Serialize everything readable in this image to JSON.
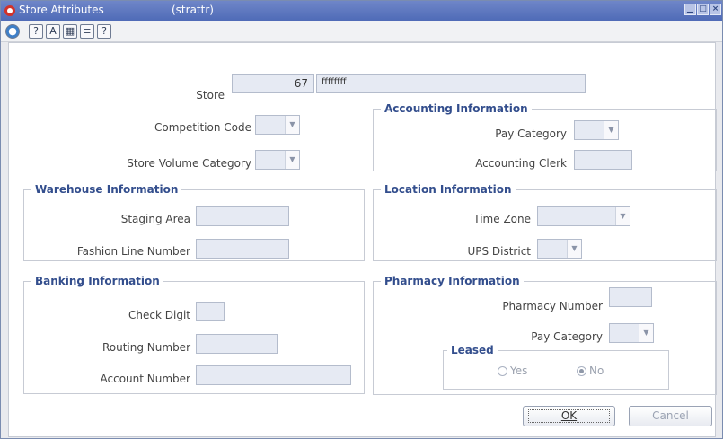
{
  "window": {
    "title": "Store Attributes",
    "code": "(strattr)"
  },
  "toolbar": {
    "icons": [
      "globe-icon",
      "help-icon",
      "text-icon",
      "table-icon",
      "document-icon",
      "question-icon"
    ]
  },
  "store": {
    "label": "Store",
    "number": "67",
    "name": "ffffffff"
  },
  "competition": {
    "label": "Competition Code",
    "value": ""
  },
  "volume": {
    "label": "Store Volume Category",
    "value": ""
  },
  "accounting": {
    "title": "Accounting Information",
    "pay_category_label": "Pay Category",
    "pay_category_value": "",
    "clerk_label": "Accounting Clerk",
    "clerk_value": ""
  },
  "warehouse": {
    "title": "Warehouse Information",
    "staging_label": "Staging Area",
    "staging_value": "",
    "fashion_label": "Fashion Line Number",
    "fashion_value": ""
  },
  "location": {
    "title": "Location Information",
    "timezone_label": "Time Zone",
    "timezone_value": "",
    "ups_label": "UPS District",
    "ups_value": ""
  },
  "banking": {
    "title": "Banking Information",
    "check_label": "Check Digit",
    "check_value": "",
    "routing_label": "Routing Number",
    "routing_value": "",
    "account_label": "Account Number",
    "account_value": ""
  },
  "pharmacy": {
    "title": "Pharmacy Information",
    "number_label": "Pharmacy Number",
    "number_value": "",
    "pay_category_label": "Pay Category",
    "pay_category_value": "",
    "leased_title": "Leased",
    "yes_label": "Yes",
    "no_label": "No",
    "selected": "No"
  },
  "buttons": {
    "ok": "OK",
    "cancel": "Cancel"
  }
}
